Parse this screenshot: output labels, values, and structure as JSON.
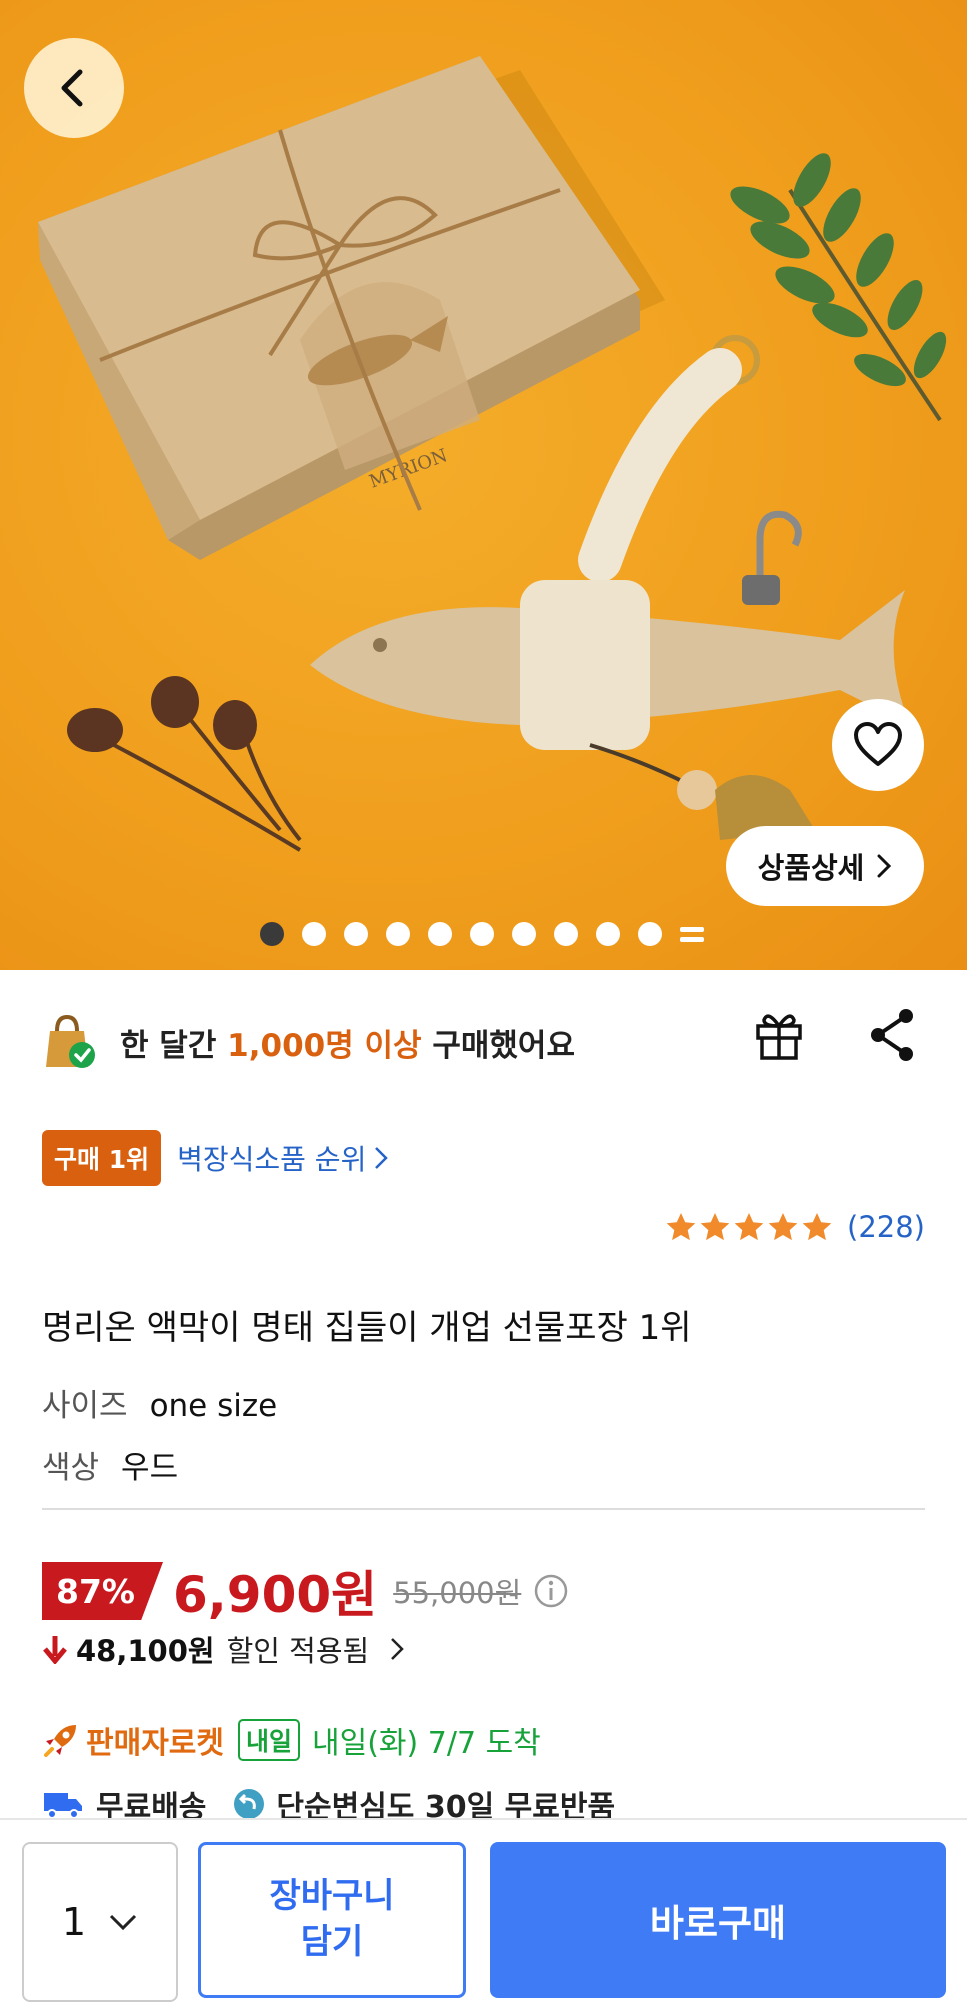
{
  "hero": {
    "box_brand": "MYRION",
    "back_icon": "chevron-left-icon",
    "heart_icon": "heart-icon",
    "detail_label": "상품상세",
    "carousel": {
      "total_slides": 11,
      "active_index": 0
    }
  },
  "purchase": {
    "prefix": "한 달간 ",
    "highlight": "1,000명 이상",
    "suffix": " 구매했어요"
  },
  "rank": {
    "badge": "구매 1위",
    "category_link": "벽장식소품 순위"
  },
  "rating": {
    "stars": 5,
    "count": "(228)"
  },
  "product": {
    "title": "명리온 액막이 명태 집들이 개업 선물포장 1위",
    "options": [
      {
        "key": "사이즈",
        "value": "one size"
      },
      {
        "key": "색상",
        "value": "우드"
      }
    ]
  },
  "price": {
    "discount": "87%",
    "sale": "6,900원",
    "original": "55,000원",
    "discount_amount": "48,100원",
    "discount_label": "할인 적용됨"
  },
  "delivery": {
    "seller_rocket": "판매자로켓",
    "tomorrow_badge": "내일",
    "arrival": "내일(화) 7/7 도착",
    "free_shipping": "무료배송",
    "free_return": "단순변심도 30일 무료반품"
  },
  "bottom": {
    "quantity": "1",
    "cart_label": "장바구니\n담기",
    "buy_label": "바로구매"
  },
  "colors": {
    "accent_orange": "#d9600e",
    "price_red": "#c8191f",
    "primary_blue": "#3f7bf5",
    "rocket_green": "#17a23a",
    "hero_bg": "#f09f1d"
  }
}
